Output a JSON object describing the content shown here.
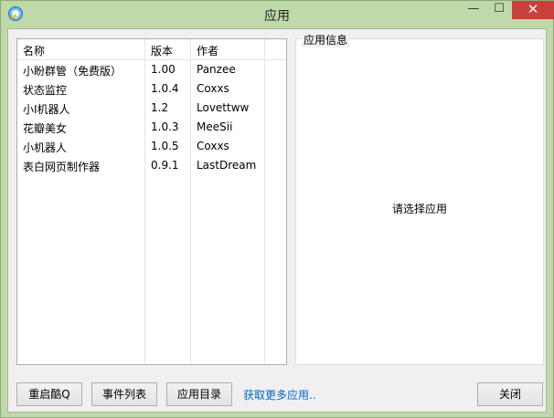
{
  "window": {
    "title": "应用",
    "minimize_glyph": "—",
    "maximize_glyph": "☐",
    "close_glyph": "✕",
    "close_color": "#c7403a",
    "frame_color": "#c0d9a8"
  },
  "list": {
    "headers": {
      "name": "名称",
      "version": "版本",
      "author": "作者"
    },
    "rows": [
      {
        "name": "小盼群管（免费版）",
        "version": "1.00",
        "author": "Panzee"
      },
      {
        "name": "状态监控",
        "version": "1.0.4",
        "author": "Coxxs"
      },
      {
        "name": "小I机器人",
        "version": "1.2",
        "author": "Lovettww"
      },
      {
        "name": "花瓣美女",
        "version": "1.0.3",
        "author": "MeeSii"
      },
      {
        "name": "小机器人",
        "version": "1.0.5",
        "author": "Coxxs"
      },
      {
        "name": "表白网页制作器",
        "version": "0.9.1",
        "author": "LastDream"
      }
    ]
  },
  "info_panel": {
    "label": "应用信息",
    "placeholder": "请选择应用"
  },
  "buttons": {
    "restart": "重启酷Q",
    "events": "事件列表",
    "app_dir": "应用目录",
    "get_more": "获取更多应用..",
    "close": "关闭"
  }
}
